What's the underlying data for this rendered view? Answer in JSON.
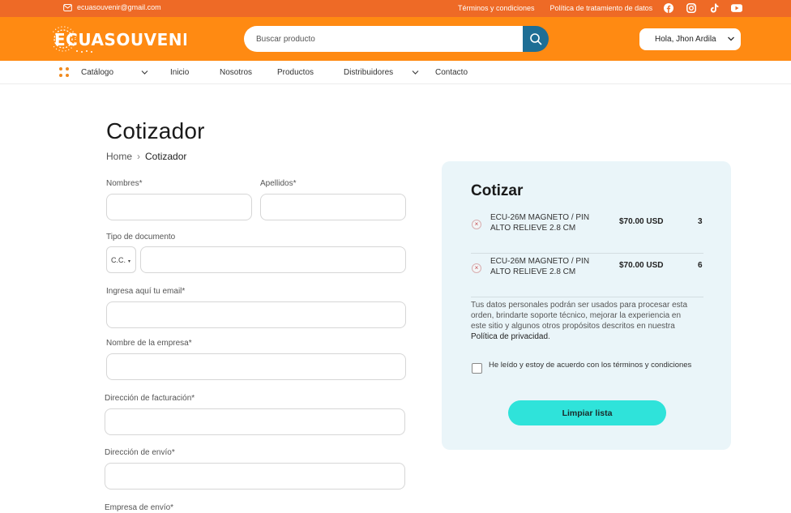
{
  "topbar": {
    "email": "ecuasouvenir@gmail.com",
    "links": [
      "Términos y condiciones",
      "Política de tratamiento de datos"
    ],
    "social_icons": [
      "facebook-icon",
      "instagram-icon",
      "tiktok-icon",
      "youtube-icon"
    ]
  },
  "header": {
    "logo_text": "ECUASOUVENIR",
    "search_placeholder": "Buscar producto",
    "user_greeting": "Hola, Jhon Ardila"
  },
  "nav": {
    "catalog": "Catálogo",
    "items": [
      "Inicio",
      "Nosotros",
      "Productos",
      "Distribuidores",
      "Contacto"
    ]
  },
  "page": {
    "title": "Cotizador",
    "breadcrumb": [
      "Home",
      "Cotizador"
    ]
  },
  "form": {
    "nombres": "Nombres*",
    "apellidos": "Apellidos*",
    "tipo_documento": "Tipo de documento",
    "doc_type_value": "C.C.",
    "email": "Ingresa aquí tu email*",
    "empresa": "Nombre de la empresa*",
    "direccion_facturacion": "Dirección de facturación*",
    "direccion_envio": "Dirección de envío*",
    "empresa_envio": "Empresa de envío*"
  },
  "quote": {
    "title": "Cotizar",
    "items": [
      {
        "name": "ECU-26M MAGNETO / PIN ALTO RELIEVE 2.8 CM",
        "price": "$70.00 USD",
        "qty": "3"
      },
      {
        "name": "ECU-26M MAGNETO / PIN ALTO RELIEVE 2.8 CM",
        "price": "$70.00 USD",
        "qty": "6"
      }
    ],
    "privacy_text": "Tus datos personales podrán ser usados para procesar esta orden, brindarte soporte técnico, mejorar la experiencia en este sitio y algunos otros propósitos descritos en nuestra",
    "privacy_link": "Política de privacidad",
    "privacy_end": ".",
    "terms_label": "He leído y estoy de acuerdo con los términos y condiciones",
    "clear_button": "Limpiar lista"
  },
  "colors": {
    "topbar": "#ee6a26",
    "header": "#ff8a12",
    "search_button": "#1e6e95",
    "panel_bg": "#eaf5f9",
    "clear_button": "#2fe3da"
  }
}
